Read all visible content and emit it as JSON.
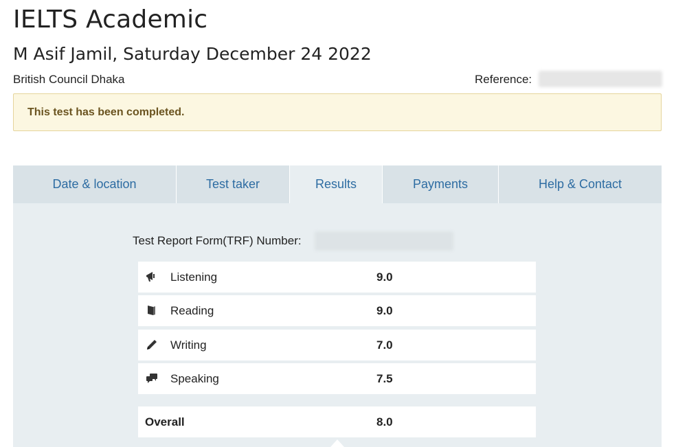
{
  "header": {
    "title": "IELTS Academic",
    "subtitle": "M Asif Jamil, Saturday December 24 2022",
    "centre": "British Council Dhaka",
    "reference_label": "Reference:"
  },
  "alert": {
    "message": "This test has been completed."
  },
  "tabs": [
    {
      "label": "Date & location"
    },
    {
      "label": "Test taker"
    },
    {
      "label": "Results"
    },
    {
      "label": "Payments"
    },
    {
      "label": "Help & Contact"
    }
  ],
  "active_tab": "Results",
  "results": {
    "trf_label": "Test Report Form(TRF) Number:",
    "scores": [
      {
        "skill": "Listening",
        "score": "9.0",
        "icon": "megaphone-icon"
      },
      {
        "skill": "Reading",
        "score": "9.0",
        "icon": "book-icon"
      },
      {
        "skill": "Writing",
        "score": "7.0",
        "icon": "pencil-icon"
      },
      {
        "skill": "Speaking",
        "score": "7.5",
        "icon": "speech-bubbles-icon"
      }
    ],
    "overall_label": "Overall",
    "overall_score": "8.0"
  },
  "colors": {
    "link": "#2d6ca2",
    "alert_bg": "#fcf7e1",
    "alert_text": "#6b5420",
    "tab_bg": "#d9e2e7",
    "panel_bg": "#e8eef1"
  }
}
